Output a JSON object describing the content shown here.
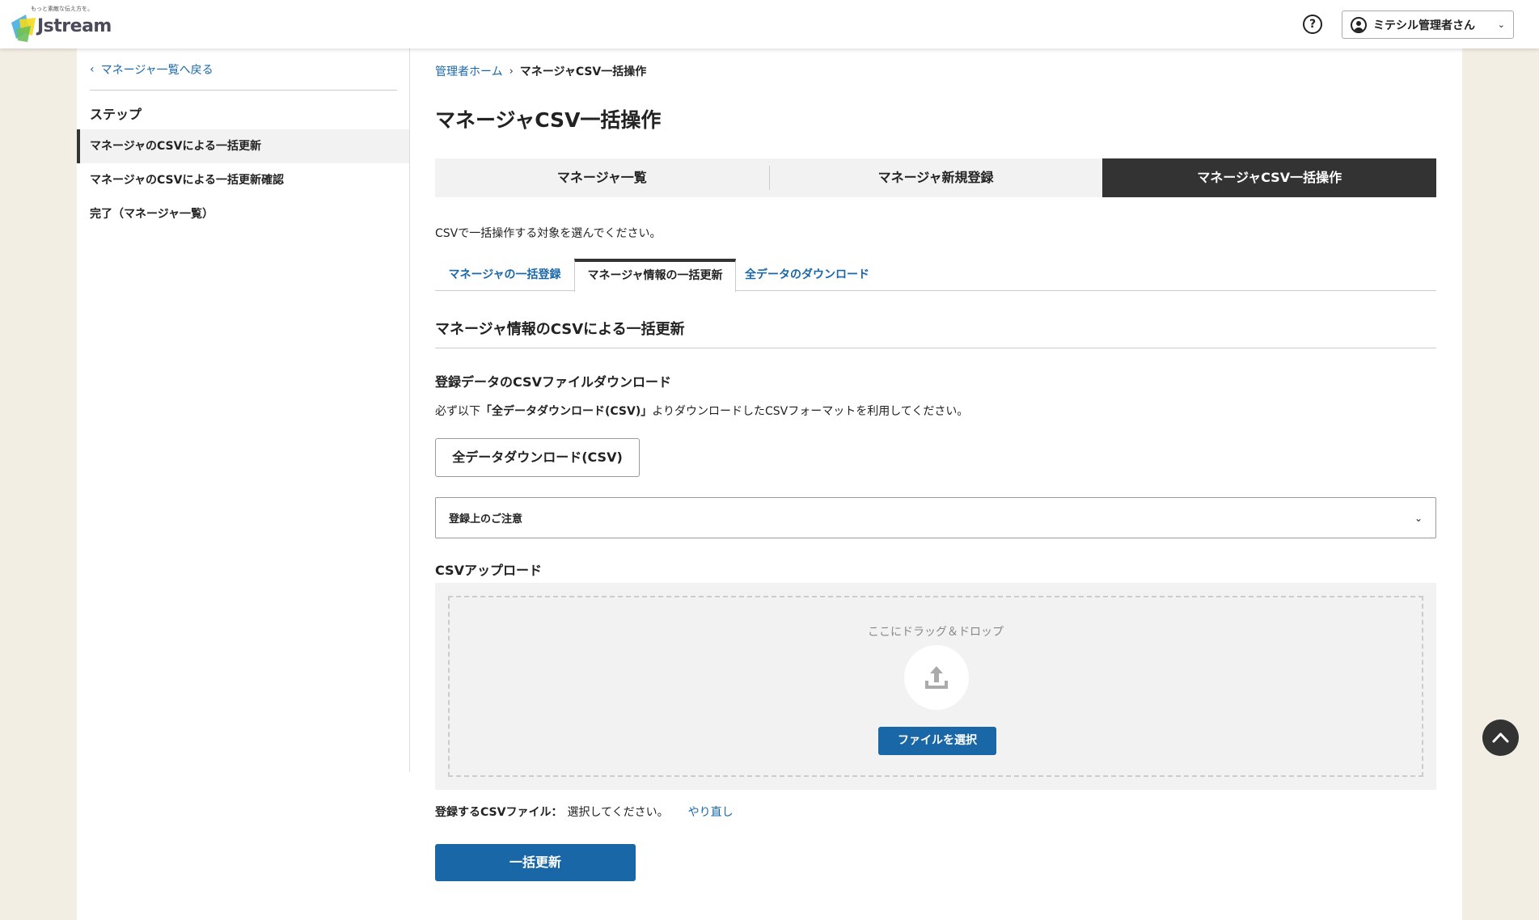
{
  "header": {
    "logo_tagline": "もっと素敵な伝え方を。",
    "logo_wordmark": "Jstream",
    "help_label": "?",
    "user_name": "ミテシル管理者さん"
  },
  "sidebar": {
    "back_link": "マネージャ一覧へ戻る",
    "steps_heading": "ステップ",
    "steps": [
      "マネージャのCSVによる一括更新",
      "マネージャのCSVによる一括更新確認",
      "完了（マネージャ一覧）"
    ]
  },
  "breadcrumb": {
    "home": "管理者ホーム",
    "current": "マネージャCSV一括操作"
  },
  "page_title": "マネージャCSV一括操作",
  "top_tabs": [
    "マネージャ一覧",
    "マネージャ新規登録",
    "マネージャCSV一括操作"
  ],
  "top_tabs_active_index": 2,
  "instruction": "CSVで一括操作する対象を選んでください。",
  "sub_tabs": [
    "マネージャの一括登録",
    "マネージャ情報の一括更新",
    "全データのダウンロード"
  ],
  "sub_tabs_active_index": 1,
  "section_title": "マネージャ情報のCSVによる一括更新",
  "download_section": {
    "title": "登録データのCSVファイルダウンロード",
    "note_prefix": "必ず以下",
    "note_bold": "「全データダウンロード(CSV)」",
    "note_suffix": "よりダウンロードしたCSVフォーマットを利用してください。",
    "button_label": "全データダウンロード(CSV)"
  },
  "accordion_label": "登録上のご注意",
  "upload_section": {
    "title": "CSVアップロード",
    "drop_text": "ここにドラッグ＆ドロップ",
    "select_button": "ファイルを選択"
  },
  "file_line": {
    "label": "登録するCSVファイル：",
    "value": "選択してください。",
    "reset": "やり直し"
  },
  "submit_label": "一括更新",
  "colors": {
    "accent": "#1a67a8",
    "active_tab": "#333333",
    "page_bg": "#f3eee4"
  },
  "icons": [
    "help-icon",
    "user-icon",
    "chevron-down-icon",
    "chevron-left-icon",
    "chevron-right-icon",
    "upload-icon",
    "chevron-up-icon"
  ]
}
